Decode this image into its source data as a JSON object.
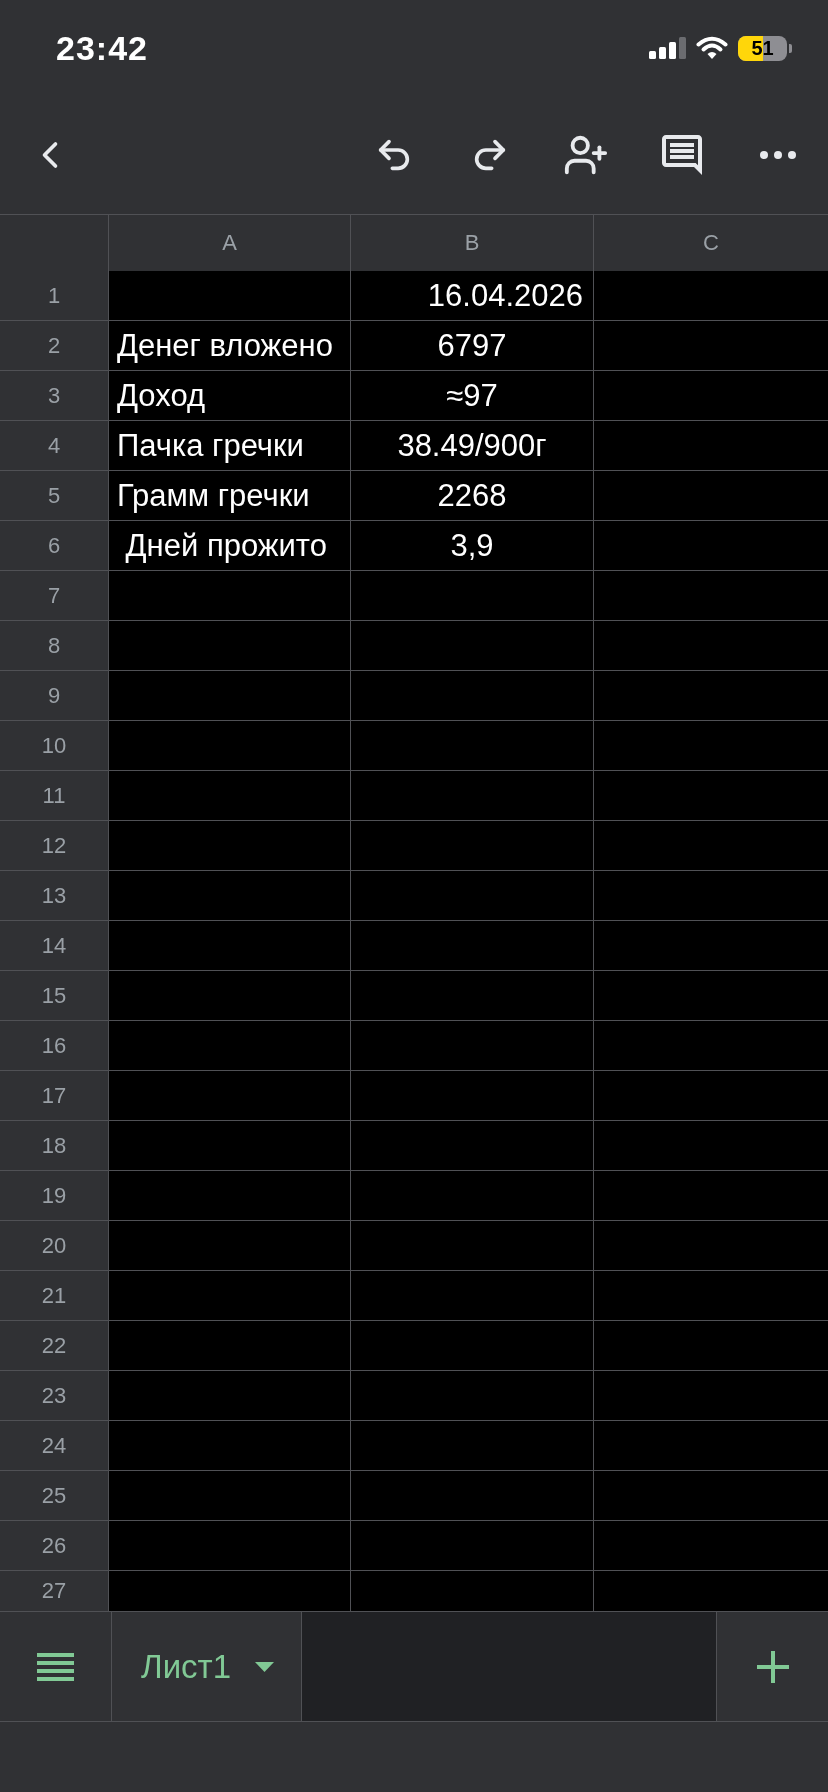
{
  "status_bar": {
    "time": "23:42",
    "battery": "51"
  },
  "sheet": {
    "columns": [
      "A",
      "B",
      "C"
    ],
    "rows": [
      {
        "number": "1",
        "column_b": {
          "text": "16.04.2026",
          "kind": "date"
        }
      },
      {
        "number": "2",
        "column_a": {
          "text": "Денег вложено",
          "kind": "label"
        },
        "column_b": {
          "text": "6797",
          "kind": "value"
        }
      },
      {
        "number": "3",
        "column_a": {
          "text": "Доход",
          "kind": "label"
        },
        "column_b": {
          "text": "≈97",
          "kind": "value"
        }
      },
      {
        "number": "4",
        "column_a": {
          "text": "Пачка гречки",
          "kind": "label"
        },
        "column_b": {
          "text": "38.49/900г",
          "kind": "value"
        }
      },
      {
        "number": "5",
        "column_a": {
          "text": "Грамм гречки",
          "kind": "label"
        },
        "column_b": {
          "text": "2268",
          "kind": "value"
        }
      },
      {
        "number": "6",
        "column_a": {
          "text": " Дней прожито",
          "kind": "label"
        },
        "column_b": {
          "text": "3,9",
          "kind": "value"
        }
      },
      {
        "number": "7"
      },
      {
        "number": "8"
      },
      {
        "number": "9"
      },
      {
        "number": "10"
      },
      {
        "number": "11"
      },
      {
        "number": "12"
      },
      {
        "number": "13"
      },
      {
        "number": "14"
      },
      {
        "number": "15"
      },
      {
        "number": "16"
      },
      {
        "number": "17"
      },
      {
        "number": "18"
      },
      {
        "number": "19"
      },
      {
        "number": "20"
      },
      {
        "number": "21"
      },
      {
        "number": "22"
      },
      {
        "number": "23"
      },
      {
        "number": "24"
      },
      {
        "number": "25"
      },
      {
        "number": "26"
      },
      {
        "number": "27"
      }
    ]
  },
  "sheet_tabs": [
    {
      "label": "Лист1",
      "selected": true
    }
  ]
}
